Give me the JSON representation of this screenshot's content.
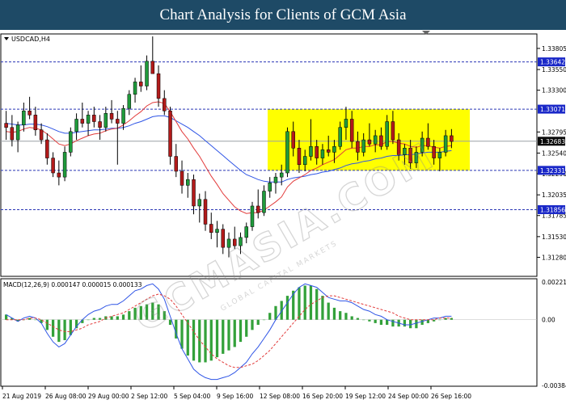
{
  "header": {
    "title": "Chart Analysis for Clients of GCM Asia"
  },
  "watermark": {
    "text": "GCMASIA.COM",
    "sub": "GLOBAL CAPITAL MARKETS"
  },
  "chart_data": [
    {
      "type": "candlestick",
      "symbol_label": "USDCAD,H4",
      "ylim": [
        1.3105,
        1.3398
      ],
      "ytick_labels": [
        "1.33805",
        "1.33550",
        "1.33300",
        "1.32795",
        "1.32540",
        "1.32290",
        "1.32035",
        "1.31785",
        "1.31530",
        "1.31280"
      ],
      "ytick_values": [
        1.33805,
        1.3355,
        1.333,
        1.32795,
        1.3254,
        1.3229,
        1.32035,
        1.31785,
        1.3153,
        1.3128
      ],
      "x_labels": [
        "21 Aug 2019",
        "26 Aug 08:00",
        "29 Aug 00:00",
        "2 Sep 12:00",
        "5 Sep 04:00",
        "9 Sep 16:00",
        "12 Sep 08:00",
        "16 Sep 20:00",
        "19 Sep 12:00",
        "24 Sep 00:00",
        "26 Sep 16:00"
      ],
      "levels": [
        {
          "value": 1.33642,
          "label": "1.33642"
        },
        {
          "value": 1.33071,
          "label": "1.33071"
        },
        {
          "value": 1.32331,
          "label": "1.32331"
        },
        {
          "value": 1.31856,
          "label": "1.31856"
        }
      ],
      "current_price": {
        "value": 1.32683,
        "label": "1.32683"
      },
      "range_box": {
        "high": 1.3307,
        "low": 1.3233
      },
      "candles": [
        [
          1.329,
          1.3305,
          1.327,
          1.3285
        ],
        [
          1.3285,
          1.33,
          1.3262,
          1.327
        ],
        [
          1.327,
          1.3292,
          1.3255,
          1.3288
        ],
        [
          1.3288,
          1.3315,
          1.328,
          1.3305
        ],
        [
          1.3305,
          1.3322,
          1.3295,
          1.33
        ],
        [
          1.33,
          1.331,
          1.3275,
          1.3282
        ],
        [
          1.3282,
          1.329,
          1.3265,
          1.327
        ],
        [
          1.327,
          1.3278,
          1.324,
          1.3248
        ],
        [
          1.3248,
          1.3255,
          1.3225,
          1.323
        ],
        [
          1.323,
          1.3245,
          1.3215,
          1.3225
        ],
        [
          1.3225,
          1.3262,
          1.322,
          1.3255
        ],
        [
          1.3255,
          1.3285,
          1.325,
          1.328
        ],
        [
          1.328,
          1.3302,
          1.327,
          1.3295
        ],
        [
          1.3295,
          1.3315,
          1.3285,
          1.329
        ],
        [
          1.329,
          1.3305,
          1.3275,
          1.33
        ],
        [
          1.33,
          1.331,
          1.3285,
          1.3292
        ],
        [
          1.3292,
          1.33,
          1.327,
          1.3285
        ],
        [
          1.3285,
          1.331,
          1.328,
          1.3302
        ],
        [
          1.3302,
          1.3318,
          1.329,
          1.3295
        ],
        [
          1.3295,
          1.3305,
          1.324,
          1.329
        ],
        [
          1.329,
          1.3312,
          1.3282,
          1.3308
        ],
        [
          1.3308,
          1.333,
          1.33,
          1.3325
        ],
        [
          1.3325,
          1.3345,
          1.3315,
          1.334
        ],
        [
          1.334,
          1.336,
          1.3328,
          1.3335
        ],
        [
          1.3335,
          1.3372,
          1.333,
          1.3365
        ],
        [
          1.3365,
          1.3395,
          1.3355,
          1.335
        ],
        [
          1.335,
          1.336,
          1.331,
          1.332
        ],
        [
          1.332,
          1.333,
          1.33,
          1.3305
        ],
        [
          1.3305,
          1.331,
          1.324,
          1.325
        ],
        [
          1.325,
          1.3265,
          1.3225,
          1.3232
        ],
        [
          1.3232,
          1.3245,
          1.3205,
          1.3215
        ],
        [
          1.3215,
          1.323,
          1.32,
          1.3222
        ],
        [
          1.3222,
          1.3228,
          1.318,
          1.319
        ],
        [
          1.319,
          1.3205,
          1.317,
          1.3198
        ],
        [
          1.3198,
          1.3208,
          1.316,
          1.3168
        ],
        [
          1.3168,
          1.3182,
          1.315,
          1.3158
        ],
        [
          1.3158,
          1.3172,
          1.314,
          1.3162
        ],
        [
          1.3162,
          1.3168,
          1.3132,
          1.314
        ],
        [
          1.314,
          1.3158,
          1.3128,
          1.315
        ],
        [
          1.315,
          1.3165,
          1.3138,
          1.3142
        ],
        [
          1.3142,
          1.3158,
          1.3132,
          1.3152
        ],
        [
          1.3152,
          1.317,
          1.3145,
          1.3165
        ],
        [
          1.3165,
          1.3195,
          1.316,
          1.319
        ],
        [
          1.319,
          1.321,
          1.3175,
          1.3182
        ],
        [
          1.3182,
          1.3215,
          1.3178,
          1.3208
        ],
        [
          1.3208,
          1.3225,
          1.32,
          1.3218
        ],
        [
          1.3218,
          1.323,
          1.3205,
          1.3225
        ],
        [
          1.3225,
          1.324,
          1.3215,
          1.323
        ],
        [
          1.323,
          1.3285,
          1.3225,
          1.328
        ],
        [
          1.328,
          1.3292,
          1.325,
          1.326
        ],
        [
          1.326,
          1.327,
          1.323,
          1.324
        ],
        [
          1.324,
          1.3258,
          1.3232,
          1.325
        ],
        [
          1.325,
          1.3295,
          1.3245,
          1.3262
        ],
        [
          1.3262,
          1.327,
          1.324,
          1.3248
        ],
        [
          1.3248,
          1.3265,
          1.324,
          1.3258
        ],
        [
          1.3258,
          1.3275,
          1.325,
          1.3255
        ],
        [
          1.3255,
          1.327,
          1.3242,
          1.3262
        ],
        [
          1.3262,
          1.3292,
          1.3258,
          1.3285
        ],
        [
          1.3285,
          1.331,
          1.327,
          1.3295
        ],
        [
          1.3295,
          1.3305,
          1.326,
          1.3268
        ],
        [
          1.3268,
          1.328,
          1.3245,
          1.3255
        ],
        [
          1.3255,
          1.3278,
          1.325,
          1.327
        ],
        [
          1.327,
          1.329,
          1.3262,
          1.3265
        ],
        [
          1.3265,
          1.3282,
          1.3255,
          1.3275
        ],
        [
          1.3275,
          1.3285,
          1.3258,
          1.3262
        ],
        [
          1.3262,
          1.33,
          1.3258,
          1.3292
        ],
        [
          1.3292,
          1.3305,
          1.3265,
          1.327
        ],
        [
          1.327,
          1.3278,
          1.3245,
          1.3252
        ],
        [
          1.3252,
          1.3265,
          1.324,
          1.326
        ],
        [
          1.326,
          1.327,
          1.3235,
          1.3242
        ],
        [
          1.3242,
          1.3262,
          1.3236,
          1.3255
        ],
        [
          1.3255,
          1.328,
          1.325,
          1.3272
        ],
        [
          1.3272,
          1.329,
          1.3258,
          1.3262
        ],
        [
          1.3262,
          1.327,
          1.324,
          1.3248
        ],
        [
          1.3248,
          1.326,
          1.3232,
          1.3255
        ],
        [
          1.3255,
          1.3282,
          1.325,
          1.3275
        ],
        [
          1.3275,
          1.3283,
          1.326,
          1.3268
        ]
      ],
      "ema_red": [
        1.328,
        1.3279,
        1.328,
        1.3283,
        1.3285,
        1.3284,
        1.3282,
        1.3277,
        1.3271,
        1.3265,
        1.3263,
        1.3265,
        1.3269,
        1.3272,
        1.3275,
        1.3277,
        1.3278,
        1.3281,
        1.3283,
        1.3284,
        1.3288,
        1.3293,
        1.3299,
        1.3304,
        1.3311,
        1.3315,
        1.3316,
        1.3314,
        1.3304,
        1.3292,
        1.328,
        1.3271,
        1.326,
        1.325,
        1.3238,
        1.3226,
        1.3216,
        1.3205,
        1.3197,
        1.3189,
        1.3184,
        1.3181,
        1.3182,
        1.3182,
        1.3185,
        1.319,
        1.3195,
        1.3201,
        1.3213,
        1.322,
        1.3224,
        1.3228,
        1.3233,
        1.3236,
        1.324,
        1.3243,
        1.3246,
        1.3252,
        1.3258,
        1.326,
        1.326,
        1.3262,
        1.3262,
        1.3264,
        1.3264,
        1.3268,
        1.3268,
        1.3266,
        1.3265,
        1.3262,
        1.3261,
        1.3263,
        1.3263,
        1.3261,
        1.326,
        1.3262,
        1.3263
      ],
      "ema_blue": [
        1.329,
        1.3289,
        1.3288,
        1.3288,
        1.3289,
        1.3289,
        1.3288,
        1.3286,
        1.3283,
        1.328,
        1.3278,
        1.3278,
        1.3279,
        1.328,
        1.3281,
        1.3282,
        1.3282,
        1.3283,
        1.3284,
        1.3284,
        1.3285,
        1.3287,
        1.329,
        1.3292,
        1.3295,
        1.3298,
        1.3299,
        1.3299,
        1.3297,
        1.3293,
        1.3289,
        1.3285,
        1.328,
        1.3275,
        1.3269,
        1.3263,
        1.3257,
        1.3251,
        1.3245,
        1.3239,
        1.3233,
        1.3228,
        1.3225,
        1.3222,
        1.322,
        1.3219,
        1.3219,
        1.3219,
        1.3222,
        1.3224,
        1.3225,
        1.3226,
        1.3228,
        1.3229,
        1.3231,
        1.3232,
        1.3234,
        1.3236,
        1.3239,
        1.3241,
        1.3242,
        1.3244,
        1.3245,
        1.3247,
        1.3248,
        1.325,
        1.3251,
        1.3251,
        1.3252,
        1.3252,
        1.3253,
        1.3254,
        1.3255,
        1.3255,
        1.3255,
        1.3256,
        1.3257
      ]
    },
    {
      "type": "macd",
      "label": "MACD(12,26,9) 0.000147 0.000015 0.000133",
      "ylim": [
        -0.0039,
        0.0024
      ],
      "ytick_labels": [
        "0.002215",
        "0.00",
        "-0.003844"
      ],
      "ytick_values": [
        0.002215,
        0,
        -0.003844
      ],
      "histogram": [
        0.0003,
        0.0001,
        -0.0001,
        0.0,
        0.0001,
        0.0,
        -0.0002,
        -0.0006,
        -0.001,
        -0.0013,
        -0.0012,
        -0.0009,
        -0.0005,
        -0.0002,
        0.0,
        0.0001,
        0.0001,
        0.0002,
        0.0002,
        0.0002,
        0.0003,
        0.0005,
        0.0007,
        0.0008,
        0.0009,
        0.001,
        0.0009,
        0.0005,
        -0.0003,
        -0.0011,
        -0.0017,
        -0.0021,
        -0.0024,
        -0.0025,
        -0.0025,
        -0.0024,
        -0.0022,
        -0.002,
        -0.0018,
        -0.0016,
        -0.0013,
        -0.001,
        -0.0006,
        -0.0003,
        0.0,
        0.0004,
        0.0008,
        0.0011,
        0.0014,
        0.0017,
        0.0019,
        0.002,
        0.002,
        0.0018,
        0.0014,
        0.001,
        0.0007,
        0.0005,
        0.0004,
        0.0002,
        0.0001,
        0.0,
        -0.0001,
        -0.0002,
        -0.0003,
        -0.0003,
        -0.0004,
        -0.0004,
        -0.0004,
        -0.0005,
        -0.0005,
        -0.0003,
        -0.0002,
        -0.0001,
        0.0,
        0.0001,
        0.0001
      ],
      "macd_line": [
        0.0003,
        0.0001,
        -0.0001,
        0.0001,
        0.0002,
        0.0001,
        -0.0002,
        -0.0008,
        -0.0013,
        -0.0016,
        -0.0014,
        -0.0009,
        -0.0004,
        0.0,
        0.0003,
        0.0005,
        0.0006,
        0.0008,
        0.0009,
        0.0009,
        0.0011,
        0.0014,
        0.0017,
        0.0018,
        0.002,
        0.0021,
        0.0018,
        0.0012,
        0.0002,
        -0.0008,
        -0.0017,
        -0.0023,
        -0.0029,
        -0.0032,
        -0.0034,
        -0.0035,
        -0.0035,
        -0.0034,
        -0.0033,
        -0.0031,
        -0.0028,
        -0.0025,
        -0.002,
        -0.0016,
        -0.0011,
        -0.0006,
        0.0,
        0.0005,
        0.001,
        0.0015,
        0.0019,
        0.0021,
        0.002,
        0.0019,
        0.0016,
        0.0013,
        0.0012,
        0.0011,
        0.0011,
        0.001,
        0.0008,
        0.0006,
        0.0005,
        0.0003,
        0.0002,
        0.0,
        -0.0001,
        -0.0002,
        -0.0003,
        -0.0003,
        -0.0002,
        -0.0001,
        0.0,
        0.0001,
        0.0001,
        0.0002,
        0.0002
      ],
      "signal_line": [
        0.0,
        0.0,
        0.0,
        0.0,
        0.0001,
        0.0001,
        0.0,
        -0.0002,
        -0.0004,
        -0.0006,
        -0.0007,
        -0.0007,
        -0.0006,
        -0.0005,
        -0.0003,
        -0.0002,
        -0.0001,
        0.0001,
        0.0002,
        0.0003,
        0.0004,
        0.0006,
        0.0008,
        0.001,
        0.0012,
        0.0014,
        0.0015,
        0.0014,
        0.0012,
        0.0008,
        0.0003,
        -0.0002,
        -0.0007,
        -0.0012,
        -0.0016,
        -0.002,
        -0.0023,
        -0.0025,
        -0.0027,
        -0.0028,
        -0.0028,
        -0.0027,
        -0.0026,
        -0.0024,
        -0.0021,
        -0.0018,
        -0.0014,
        -0.001,
        -0.0006,
        -0.0002,
        0.0002,
        0.0006,
        0.0009,
        0.0011,
        0.0013,
        0.0014,
        0.0014,
        0.0013,
        0.0012,
        0.0011,
        0.001,
        0.0009,
        0.0008,
        0.0007,
        0.0006,
        0.0005,
        0.0004,
        0.0002,
        0.0001,
        0.0,
        0.0,
        0.0,
        0.0,
        0.0,
        0.0001,
        0.0001,
        0.0001
      ]
    }
  ],
  "colors": {
    "header_bg": "#1e4a66",
    "bull": "#1f9a3b",
    "bear": "#b21a1a",
    "ema_red": "#e23b3b",
    "ema_blue": "#2f55e6",
    "level_line": "#2a36b5",
    "level_tag": "#1a28c8",
    "current_tag": "#0a0a0a",
    "box_fill": "#ffff00",
    "histogram": "#33a13a"
  }
}
